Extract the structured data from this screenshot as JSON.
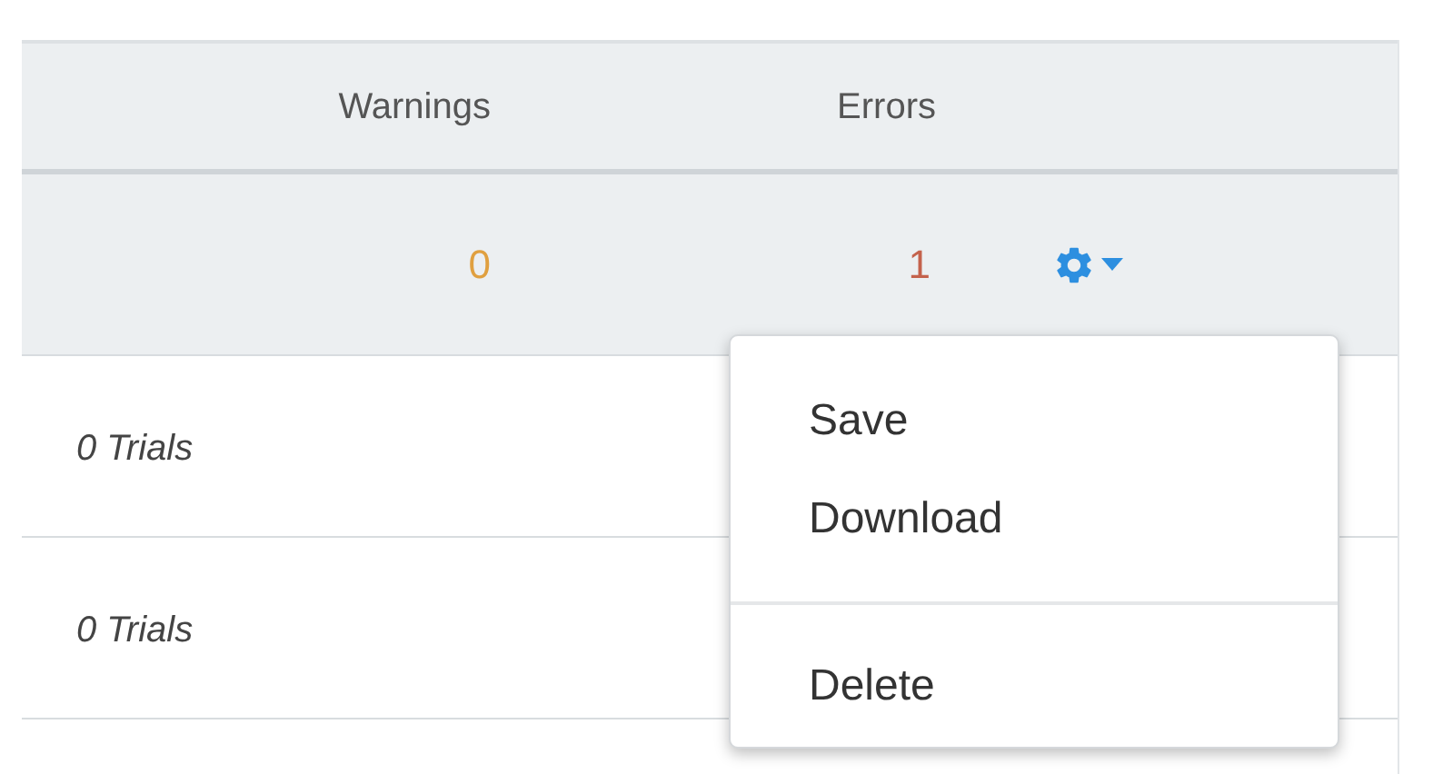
{
  "table": {
    "columns": [
      "Warnings",
      "Errors"
    ],
    "rows": [
      {
        "selected": true,
        "warnings": "0",
        "errors": "1"
      },
      {
        "selected": false,
        "trials": "0 Trials"
      },
      {
        "selected": false,
        "trials": "0 Trials"
      }
    ]
  },
  "menu": {
    "open": true,
    "items": [
      {
        "kind": "item",
        "label": "Save"
      },
      {
        "kind": "item",
        "label": "Download"
      },
      {
        "kind": "divider"
      },
      {
        "kind": "item",
        "label": "Delete"
      }
    ]
  }
}
